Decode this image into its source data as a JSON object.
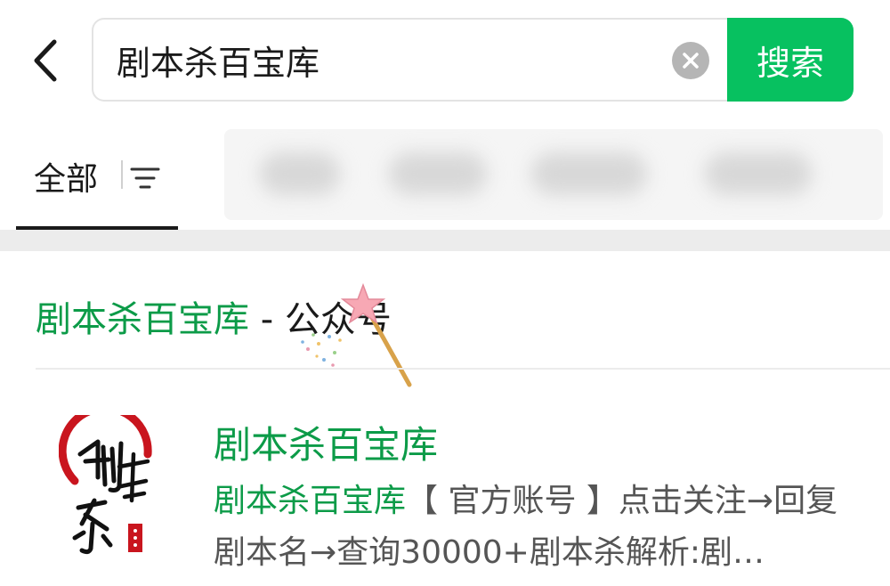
{
  "search": {
    "query": "剧本杀百宝库",
    "button_label": "搜索"
  },
  "tabs": {
    "active_label": "全部"
  },
  "section": {
    "highlight": "剧本杀百宝库",
    "separator": " - ",
    "suffix": "公众号"
  },
  "result": {
    "name": "剧本杀百宝库",
    "desc_highlight": "剧本杀百宝库",
    "desc_text": "【 官方账号 】点击关注→回复剧本名→查询30000+剧本杀解析:剧…"
  },
  "colors": {
    "accent_green": "#07c160",
    "text_green": "#0c9b48"
  },
  "icons": {
    "back": "chevron-left-icon",
    "clear": "clear-icon",
    "filter": "filter-icon",
    "wand": "magic-wand-icon"
  }
}
